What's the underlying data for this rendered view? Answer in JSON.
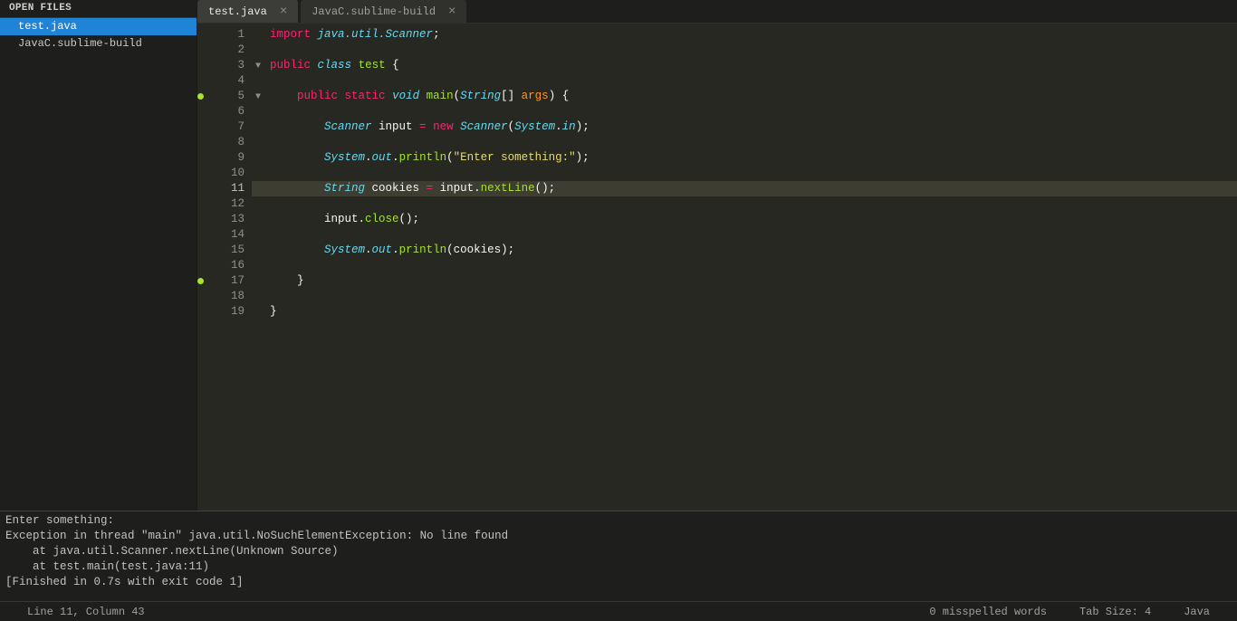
{
  "sidebar": {
    "header": "OPEN FILES",
    "items": [
      {
        "label": "test.java",
        "active": true
      },
      {
        "label": "JavaC.sublime-build",
        "active": false
      }
    ]
  },
  "tabs": [
    {
      "label": "test.java",
      "active": true
    },
    {
      "label": "JavaC.sublime-build",
      "active": false
    }
  ],
  "code": {
    "highlight_line": 11,
    "mark_lines": [
      5,
      17
    ],
    "fold_lines": [
      3,
      5
    ],
    "lines": [
      [
        [
          "k-red",
          "import"
        ],
        [
          "k-white",
          " "
        ],
        [
          "k-cyan",
          "java.util.Scanner"
        ],
        [
          "k-white",
          ";"
        ]
      ],
      [],
      [
        [
          "k-red",
          "public"
        ],
        [
          "k-white",
          " "
        ],
        [
          "k-cyan",
          "class"
        ],
        [
          "k-white",
          " "
        ],
        [
          "k-green",
          "test"
        ],
        [
          "k-white",
          " {"
        ]
      ],
      [],
      [
        [
          "k-white",
          "    "
        ],
        [
          "k-red",
          "public"
        ],
        [
          "k-white",
          " "
        ],
        [
          "k-red",
          "static"
        ],
        [
          "k-white",
          " "
        ],
        [
          "k-cyan",
          "void"
        ],
        [
          "k-white",
          " "
        ],
        [
          "k-green",
          "main"
        ],
        [
          "k-white",
          "("
        ],
        [
          "k-cyan",
          "String"
        ],
        [
          "k-white",
          "[] "
        ],
        [
          "k-orange",
          "args"
        ],
        [
          "k-white",
          ") {"
        ]
      ],
      [],
      [
        [
          "k-white",
          "        "
        ],
        [
          "k-cyan",
          "Scanner"
        ],
        [
          "k-white",
          " input "
        ],
        [
          "k-red",
          "="
        ],
        [
          "k-white",
          " "
        ],
        [
          "k-red",
          "new"
        ],
        [
          "k-white",
          " "
        ],
        [
          "k-cyan",
          "Scanner"
        ],
        [
          "k-white",
          "("
        ],
        [
          "k-cyan",
          "System"
        ],
        [
          "k-white",
          "."
        ],
        [
          "k-cyan",
          "in"
        ],
        [
          "k-white",
          ");"
        ]
      ],
      [],
      [
        [
          "k-white",
          "        "
        ],
        [
          "k-cyan",
          "System"
        ],
        [
          "k-white",
          "."
        ],
        [
          "k-cyan",
          "out"
        ],
        [
          "k-white",
          "."
        ],
        [
          "k-green",
          "println"
        ],
        [
          "k-white",
          "("
        ],
        [
          "k-yellow",
          "\"Enter something:\""
        ],
        [
          "k-white",
          ");"
        ]
      ],
      [],
      [
        [
          "k-white",
          "        "
        ],
        [
          "k-cyan",
          "String"
        ],
        [
          "k-white",
          " cookies "
        ],
        [
          "k-red",
          "="
        ],
        [
          "k-white",
          " input."
        ],
        [
          "k-green",
          "nextLine"
        ],
        [
          "k-white",
          "();"
        ]
      ],
      [],
      [
        [
          "k-white",
          "        input."
        ],
        [
          "k-green",
          "close"
        ],
        [
          "k-white",
          "();"
        ]
      ],
      [],
      [
        [
          "k-white",
          "        "
        ],
        [
          "k-cyan",
          "System"
        ],
        [
          "k-white",
          "."
        ],
        [
          "k-cyan",
          "out"
        ],
        [
          "k-white",
          "."
        ],
        [
          "k-green",
          "println"
        ],
        [
          "k-white",
          "(cookies);"
        ]
      ],
      [],
      [
        [
          "k-white",
          "    }"
        ]
      ],
      [],
      [
        [
          "k-white",
          "}"
        ]
      ]
    ]
  },
  "console": {
    "lines": [
      "Enter something:",
      "Exception in thread \"main\" java.util.NoSuchElementException: No line found",
      "    at java.util.Scanner.nextLine(Unknown Source)",
      "    at test.main(test.java:11)",
      "[Finished in 0.7s with exit code 1]"
    ]
  },
  "status": {
    "position": "Line 11, Column 43",
    "spell": "0 misspelled words",
    "tabsize": "Tab Size: 4",
    "syntax": "Java"
  }
}
